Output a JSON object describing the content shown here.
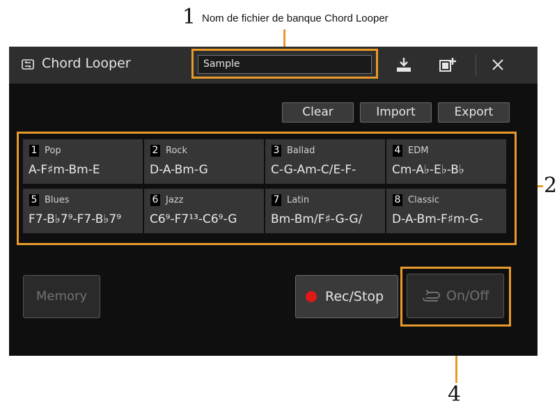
{
  "callouts": {
    "c1_number": "1",
    "c1_text": "Nom de fichier de banque Chord Looper",
    "c2_number": "2",
    "c4_number": "4"
  },
  "titlebar": {
    "title": "Chord Looper",
    "bank_name": "Sample",
    "icons": [
      "chord-looper-icon",
      "save-icon",
      "new-bank-icon",
      "close-icon"
    ]
  },
  "actions": {
    "clear": "Clear",
    "import": "Import",
    "export": "Export"
  },
  "slots": [
    {
      "num": "1",
      "name": "Pop",
      "chords": "A-F♯m-Bm-E"
    },
    {
      "num": "2",
      "name": "Rock",
      "chords": "D-A-Bm-G"
    },
    {
      "num": "3",
      "name": "Ballad",
      "chords": "C-G-Am-C/E-F-"
    },
    {
      "num": "4",
      "name": "EDM",
      "chords": "Cm-A♭-E♭-B♭"
    },
    {
      "num": "5",
      "name": "Blues",
      "chords": "F7-B♭7⁹-F7-B♭7⁹"
    },
    {
      "num": "6",
      "name": "Jazz",
      "chords": "C6⁹-F7¹³-C6⁹-G"
    },
    {
      "num": "7",
      "name": "Latin",
      "chords": "Bm-Bm/F♯-G-G/"
    },
    {
      "num": "8",
      "name": "Classic",
      "chords": "D-A-Bm-F♯m-G-"
    }
  ],
  "bottom": {
    "memory": "Memory",
    "rec_stop": "Rec/Stop",
    "on_off": "On/Off"
  },
  "colors": {
    "highlight": "#e89a2a",
    "rec_dot": "#e01818",
    "screen_bg": "#0f0f0f"
  }
}
